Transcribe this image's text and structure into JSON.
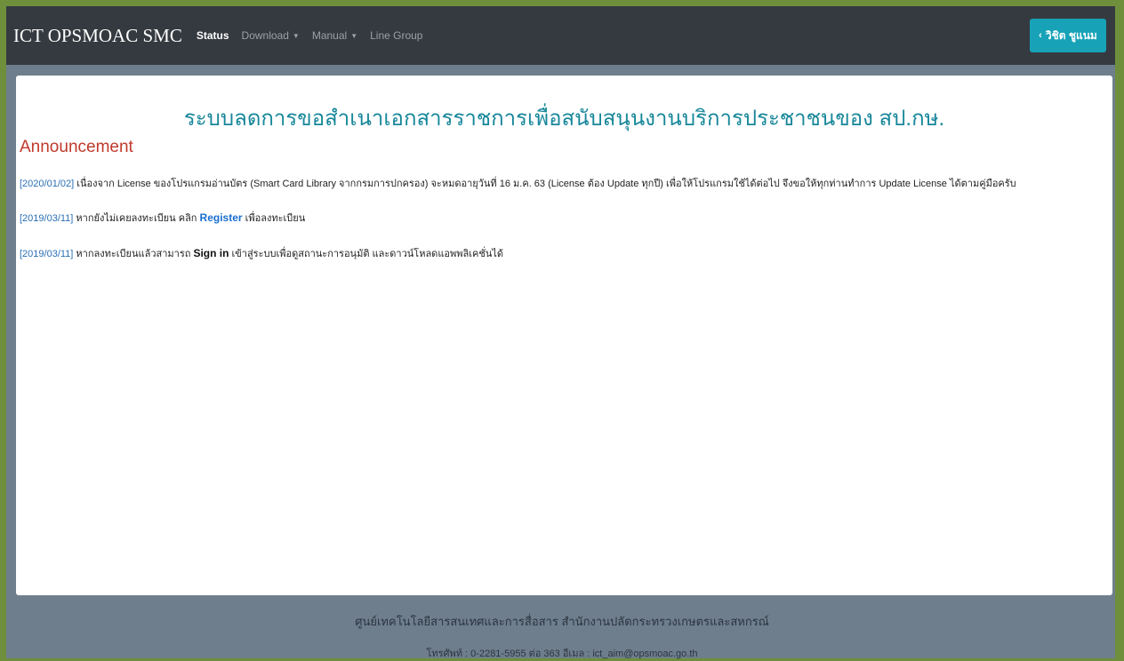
{
  "navbar": {
    "brand": "ICT OPSMOAC SMC",
    "items": [
      {
        "label": "Status"
      },
      {
        "label": "Download"
      },
      {
        "label": "Manual"
      },
      {
        "label": "Line Group"
      }
    ],
    "user_button": "วิชิต ชูแนม"
  },
  "main": {
    "title": "ระบบลดการขอสำเนาเอกสารราชการเพื่อสนับสนุนงานบริการประชาชนของ สป.กษ.",
    "announcement_heading": "Announcement",
    "announcements": [
      {
        "date": "[2020/01/02]",
        "text": "เนื่องจาก License ของโปรแกรมอ่านบัตร (Smart Card Library จากกรมการปกครอง) จะหมดอายุวันที่ 16 ม.ค. 63 (License ต้อง Update ทุกปี) เพื่อให้โปรแกรมใช้ได้ต่อไป จึงขอให้ทุกท่านทำการ Update License ได้ตามคู่มือครับ"
      },
      {
        "date": "[2019/03/11]",
        "text_before": "หากยังไม่เคยลงทะเบียน คลิก",
        "link": "Register",
        "text_after": "เพื่อลงทะเบียน"
      },
      {
        "date": "[2019/03/11]",
        "text_before": "หากลงทะเบียนแล้วสามารถ",
        "strong": "Sign in",
        "text_after": "เข้าสู่ระบบเพื่อดูสถานะการอนุมัติ และดาวน์โหลดแอพพลิเคชั่นได้"
      }
    ]
  },
  "footer": {
    "org": "ศูนย์เทคโนโลยีสารสนเทศและการสื่อสาร สำนักงานปลัดกระทรวงเกษตรและสหกรณ์",
    "contact": "โทรศัพท์ : 0-2281-5955 ต่อ 363 อีเมล : ict_aim@opsmoac.go.th"
  },
  "colors": {
    "navbar_bg": "#353a40",
    "accent": "#17a2b8",
    "title": "#17879a",
    "announcement_heading": "#c0392b"
  }
}
